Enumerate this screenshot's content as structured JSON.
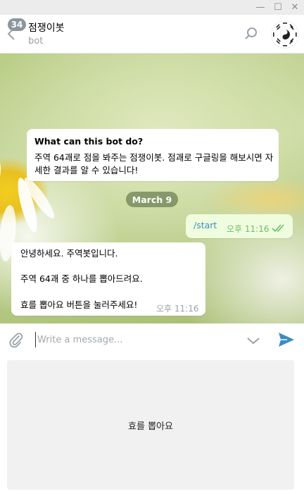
{
  "window": {
    "minimize_icon": "—",
    "maximize_icon": "☐",
    "close_icon": "✕"
  },
  "header": {
    "back_icon": "chevron-left-icon",
    "unread_badge": "34",
    "title": "점쟁이봇",
    "subtitle": "bot"
  },
  "chat": {
    "info_message": {
      "heading": "What can this bot do?",
      "body": "주역 64괘로 점을 봐주는 점쟁이봇. 점괘로 구글링을 해보시면 자세한 결과를 알 수 있습니다!"
    },
    "date_separator": "March 9",
    "outgoing": {
      "text": "/start",
      "time": "오후 11:16"
    },
    "incoming": {
      "line1": "안녕하세요. 주역봇입니다.",
      "line2": "주역 64괘 중 하나를 뽑아드려요.",
      "line3": "효를 뽑아요 버튼을 눌러주세요!",
      "time": "오후 11:16"
    }
  },
  "composer": {
    "placeholder": "Write a message...",
    "value": ""
  },
  "keyboard": {
    "button_label": "효를 뽑아요"
  },
  "colors": {
    "accent": "#3a8ebd",
    "outgoing_bubble": "#effdde",
    "read_ticks": "#6dbb6d",
    "send_icon": "#3a8ebd"
  }
}
